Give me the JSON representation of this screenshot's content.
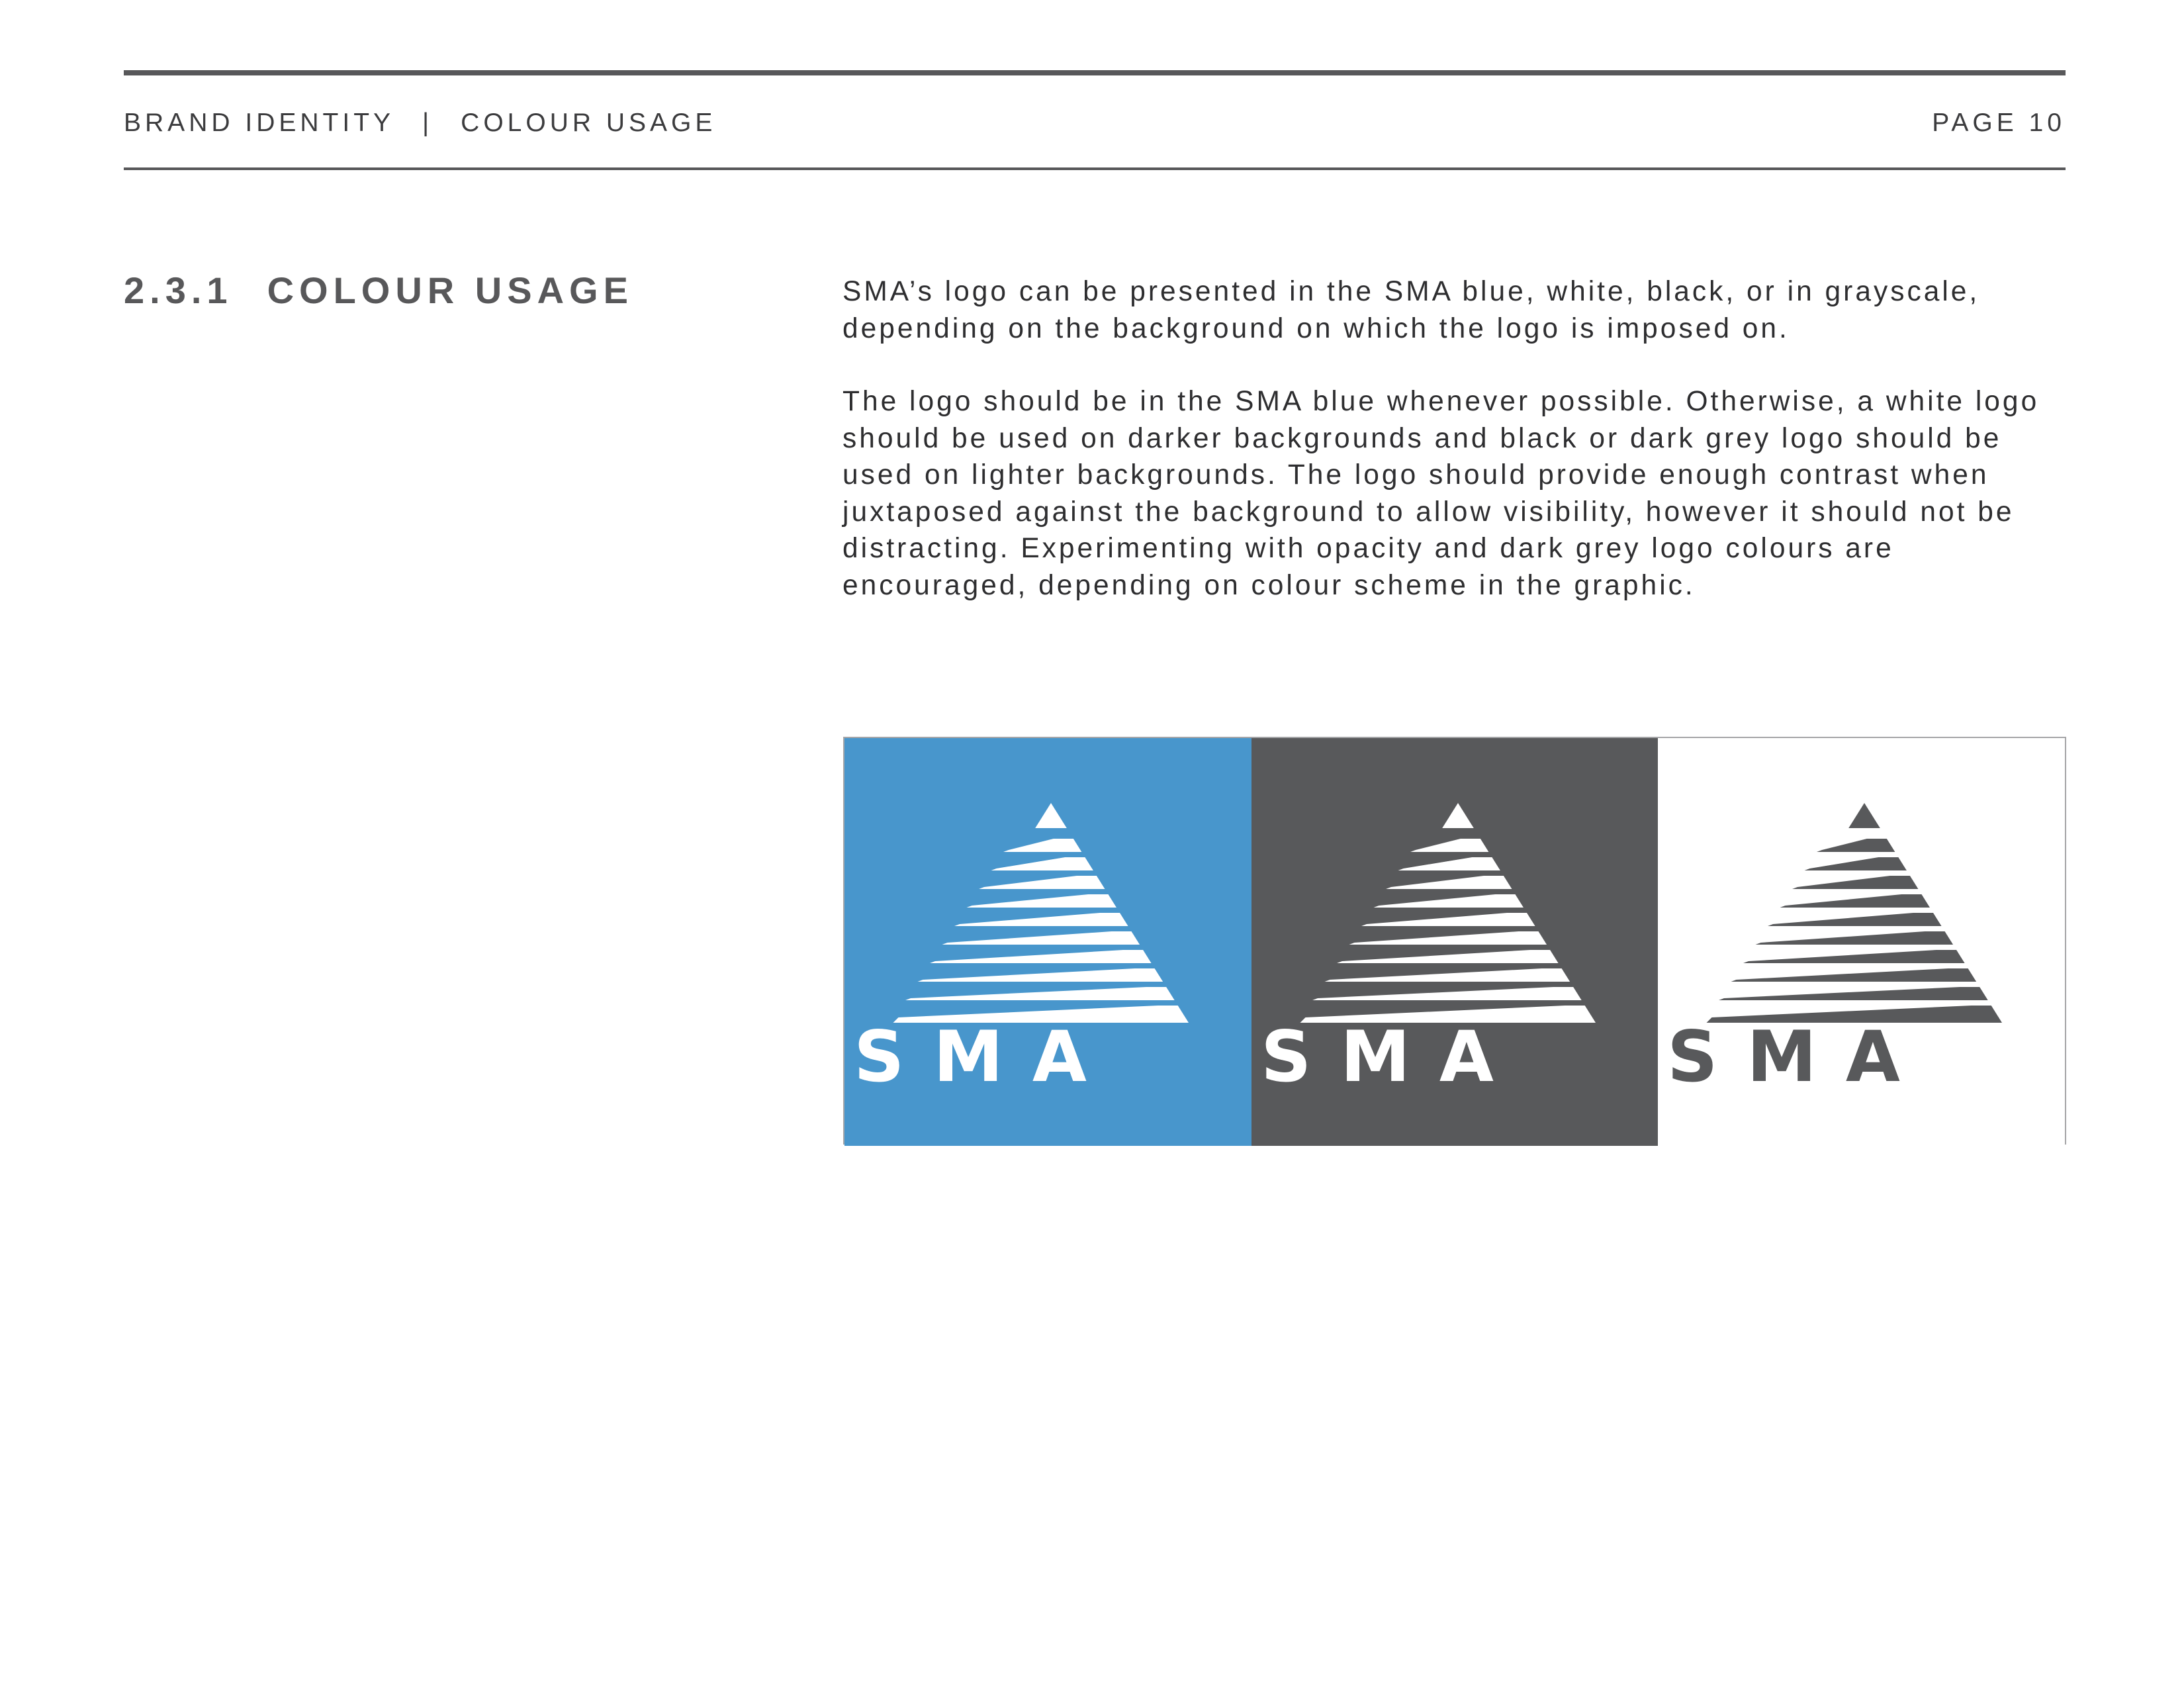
{
  "header": {
    "breadcrumb_main": "BRAND IDENTITY",
    "breadcrumb_separator": "|",
    "breadcrumb_sub": "COLOUR USAGE",
    "page": "PAGE 10"
  },
  "section": {
    "number": "2.3.1",
    "title": "COLOUR USAGE"
  },
  "body": {
    "paragraph_1": "SMA’s logo can be presented in the SMA blue, white, black, or in grayscale, depending on the background on which the logo is imposed on.",
    "paragraph_2": "The logo should be in the SMA blue whenever possible. Otherwise, a white logo should be used on darker backgrounds and black or dark grey logo should be used on lighter backgrounds. The logo should provide enough contrast when juxtaposed against the background to allow visibility, however it should not be distracting. Experimenting with opacity and dark grey logo colours are encouraged, depending on colour scheme in the graphic."
  },
  "logo_panels": [
    {
      "background": "#4896cc",
      "logo_color": "#ffffff",
      "wordmark": "SMA"
    },
    {
      "background": "#58595b",
      "logo_color": "#ffffff",
      "wordmark": "SMA"
    },
    {
      "background": "#ffffff",
      "logo_color": "#58595b",
      "wordmark": "SMA"
    }
  ],
  "colors": {
    "rule": "#58585a",
    "heading": "#58585a",
    "text": "#2e2e30",
    "sma_blue": "#4896cc",
    "dark_grey": "#58595b"
  }
}
